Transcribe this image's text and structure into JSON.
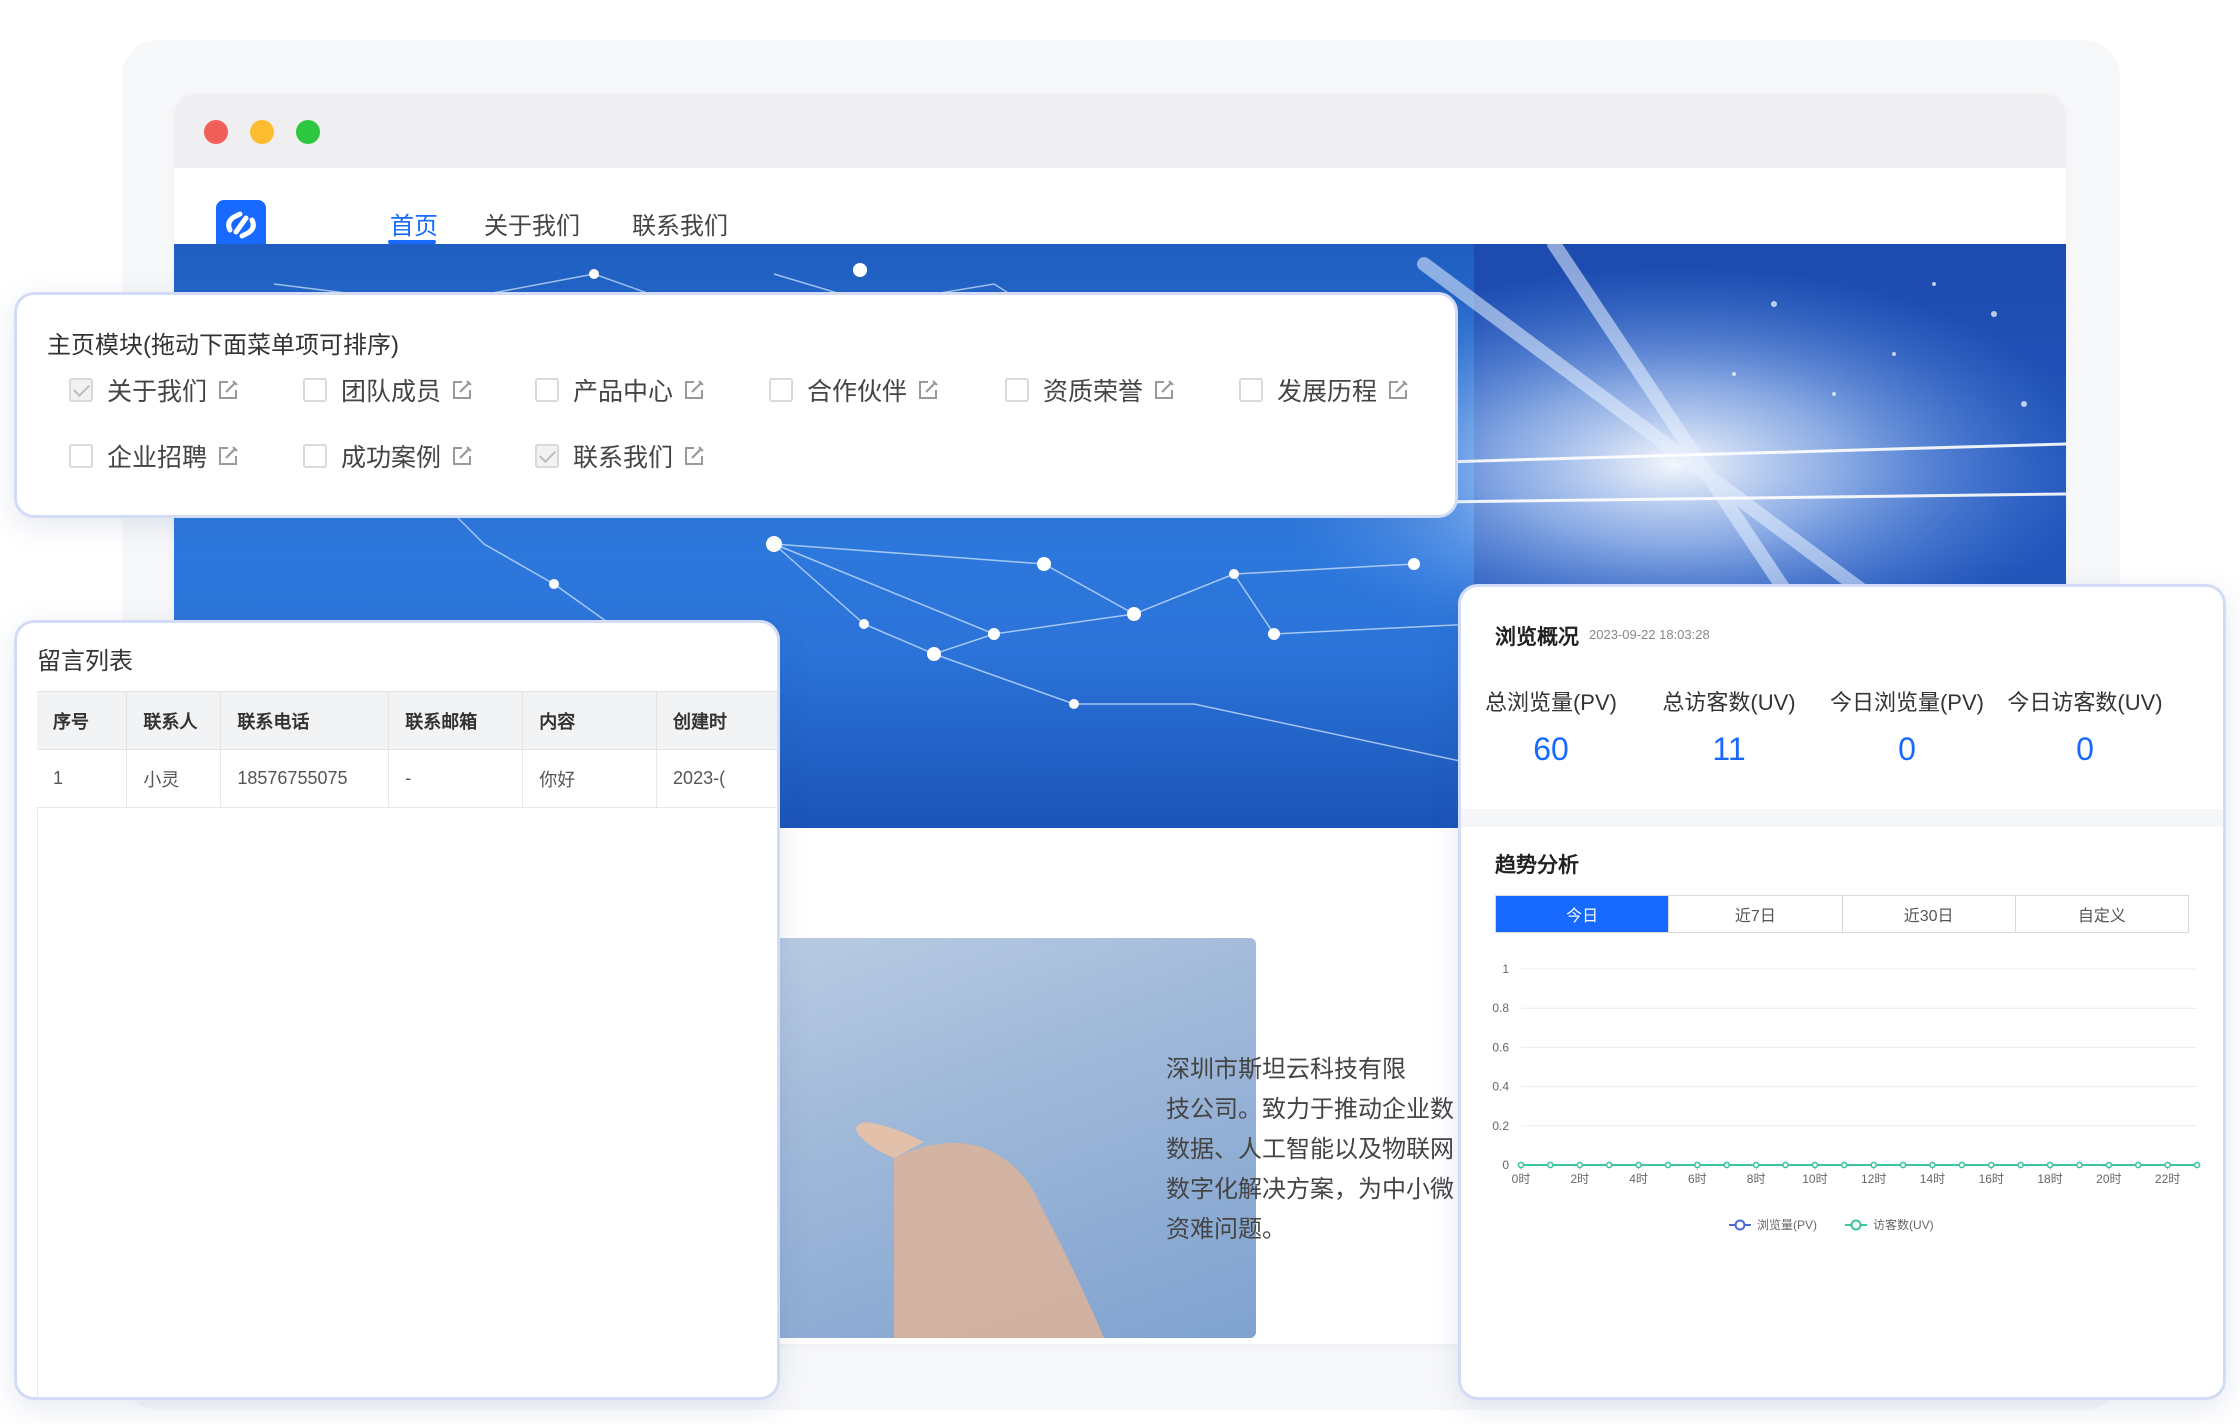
{
  "site": {
    "nav": [
      "首页",
      "关于我们",
      "联系我们"
    ],
    "intro_text": "深圳市斯坦云科技有限\n技公司。致力于推动企业数\n数据、人工智能以及物联网\n数字化解决方案，为中小微\n资难问题。"
  },
  "modules": {
    "title": "主页模块(拖动下面菜单项可排序)",
    "items": [
      {
        "label": "关于我们",
        "checked": true
      },
      {
        "label": "团队成员",
        "checked": false
      },
      {
        "label": "产品中心",
        "checked": false
      },
      {
        "label": "合作伙伴",
        "checked": false
      },
      {
        "label": "资质荣誉",
        "checked": false
      },
      {
        "label": "发展历程",
        "checked": false
      },
      {
        "label": "企业招聘",
        "checked": false
      },
      {
        "label": "成功案例",
        "checked": false
      },
      {
        "label": "联系我们",
        "checked": true
      }
    ]
  },
  "messages": {
    "title": "留言列表",
    "columns": [
      "序号",
      "联系人",
      "联系电话",
      "联系邮箱",
      "内容",
      "创建时"
    ],
    "rows": [
      [
        "1",
        "小灵",
        "18576755075",
        "-",
        "你好",
        "2023-("
      ]
    ]
  },
  "stats": {
    "title": "浏览概况",
    "timestamp": "2023-09-22 18:03:28",
    "metrics": [
      {
        "label": "总浏览量(PV)",
        "value": "60"
      },
      {
        "label": "总访客数(UV)",
        "value": "11"
      },
      {
        "label": "今日浏览量(PV)",
        "value": "0"
      },
      {
        "label": "今日访客数(UV)",
        "value": "0"
      }
    ],
    "trend_title": "趋势分析",
    "tabs": [
      "今日",
      "近7日",
      "近30日",
      "自定义"
    ],
    "active_tab": 0
  },
  "colors": {
    "accent": "#1769ff",
    "pv": "#4a6cd4",
    "uv": "#3cc6a0"
  },
  "chart_data": {
    "type": "line",
    "x": [
      "0时",
      "1时",
      "2时",
      "3时",
      "4时",
      "5时",
      "6时",
      "7时",
      "8时",
      "9时",
      "10时",
      "11时",
      "12时",
      "13时",
      "14时",
      "15时",
      "16时",
      "17时",
      "18时",
      "19时",
      "20时",
      "21时",
      "22时",
      "23时"
    ],
    "x_tick_labels": [
      "0时",
      "2时",
      "4时",
      "6时",
      "8时",
      "10时",
      "12时",
      "14时",
      "16时",
      "18时",
      "20时",
      "22时"
    ],
    "y_ticks": [
      "0",
      "0.2",
      "0.4",
      "0.6",
      "0.8",
      "1"
    ],
    "ylim": [
      0,
      1
    ],
    "series": [
      {
        "name": "浏览量(PV)",
        "values": [
          0,
          0,
          0,
          0,
          0,
          0,
          0,
          0,
          0,
          0,
          0,
          0,
          0,
          0,
          0,
          0,
          0,
          0,
          0,
          0,
          0,
          0,
          0,
          0
        ]
      },
      {
        "name": "访客数(UV)",
        "values": [
          0,
          0,
          0,
          0,
          0,
          0,
          0,
          0,
          0,
          0,
          0,
          0,
          0,
          0,
          0,
          0,
          0,
          0,
          0,
          0,
          0,
          0,
          0,
          0
        ]
      }
    ],
    "grid": true,
    "legend": "bottom"
  }
}
